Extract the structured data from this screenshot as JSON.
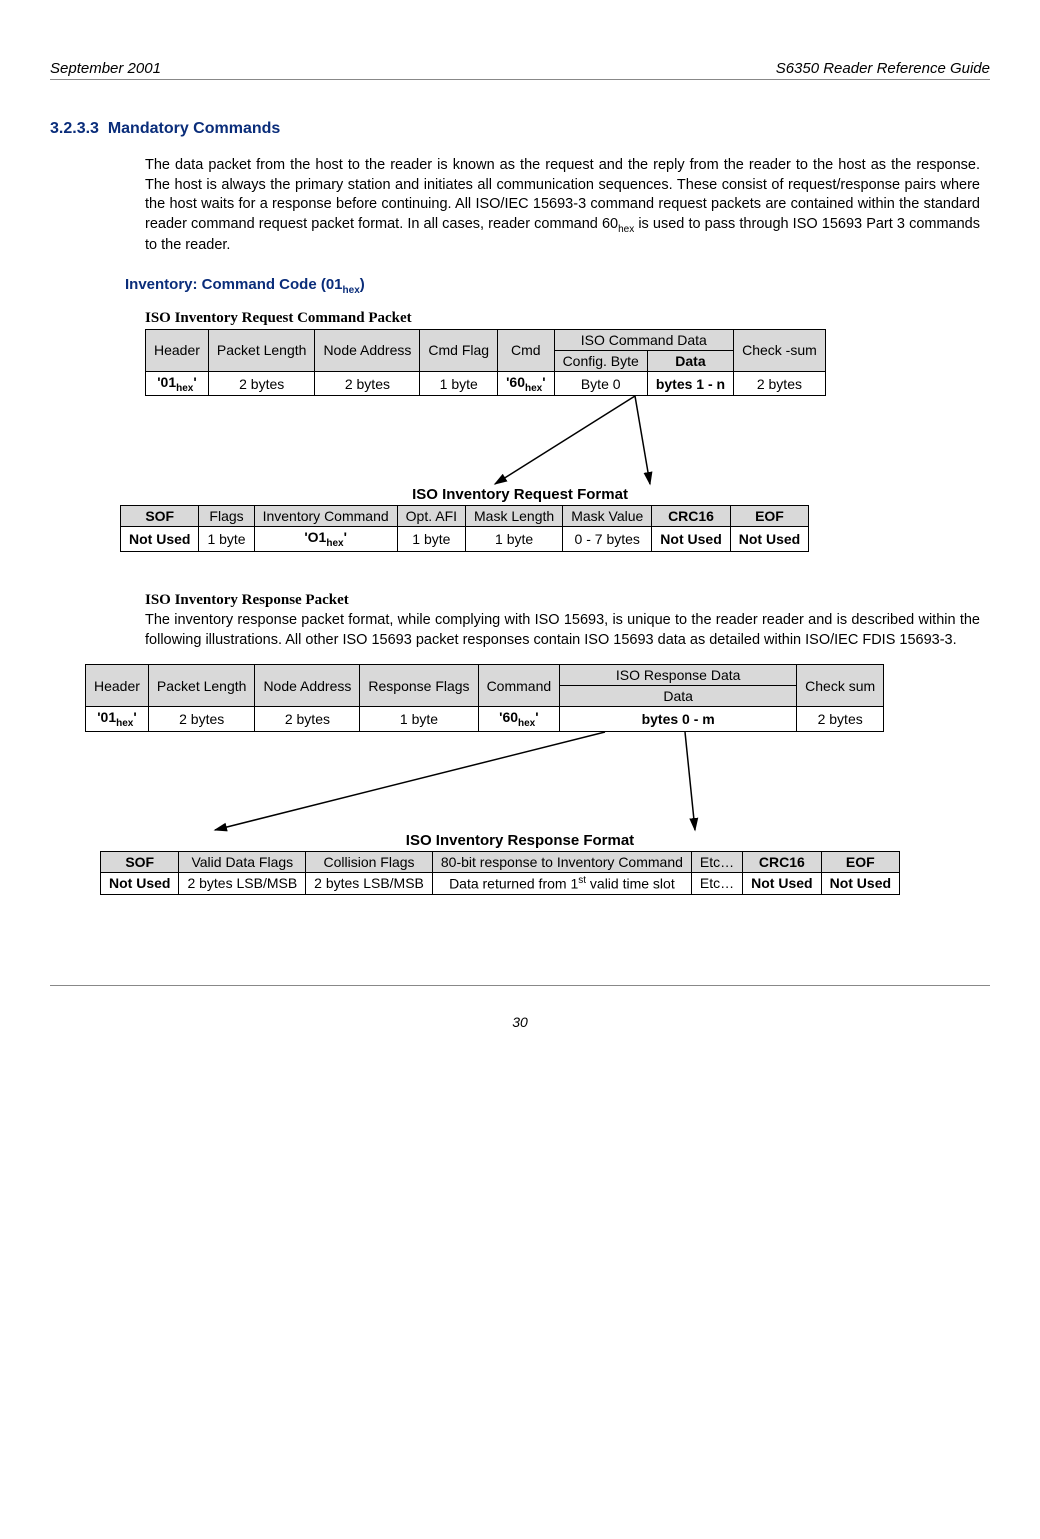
{
  "header": {
    "left": "September 2001",
    "right": "S6350 Reader Reference Guide"
  },
  "section": {
    "number": "3.2.3.3",
    "title": "Mandatory Commands"
  },
  "intro_text": "The data packet from the host to the reader is known as the request and the reply from the reader to the host as the response. The host is always the primary station and initiates all communication sequences.  These consist of request/response pairs where the host waits for a response before continuing.  All ISO/IEC 15693-3 command request packets are contained within the standard reader command request packet format.  In all cases, reader command 60",
  "intro_text_tail": " is used to pass through ISO 15693 Part 3 commands to the reader.",
  "intro_sub": "hex",
  "inventory_heading_pre": "Inventory: Command Code (01",
  "inventory_heading_sub": "hex",
  "inventory_heading_post": ")",
  "req_packet": {
    "caption": "ISO Inventory Request Command Packet",
    "headers": {
      "h1": "Header",
      "h2": "Packet Length",
      "h3": "Node Address",
      "h4": "Cmd Flag",
      "h5": "Cmd",
      "h6": "ISO Command Data",
      "h7": "Check -sum",
      "h6a": "Config. Byte",
      "h6b": "Data"
    },
    "row": {
      "c1a": "'01",
      "c1sub": "hex",
      "c1b": "'",
      "c2": "2 bytes",
      "c3": "2 bytes",
      "c4": "1 byte",
      "c5a": "'60",
      "c5sub": "hex",
      "c5b": "'",
      "c6": "Byte 0",
      "c7": "bytes 1 - n",
      "c8": "2 bytes"
    }
  },
  "req_format": {
    "caption": "ISO Inventory Request Format",
    "headers": {
      "h1": "SOF",
      "h2": "Flags",
      "h3": "Inventory Command",
      "h4": "Opt. AFI",
      "h5": "Mask Length",
      "h6": "Mask Value",
      "h7": "CRC16",
      "h8": "EOF"
    },
    "row": {
      "c1": "Not Used",
      "c2": "1 byte",
      "c3a": "'O1",
      "c3sub": "hex",
      "c3b": "'",
      "c4": "1 byte",
      "c5": "1 byte",
      "c6": "0 - 7 bytes",
      "c7": "Not Used",
      "c8": "Not Used"
    }
  },
  "resp_packet": {
    "caption": "ISO Inventory Response Packet",
    "text": "The inventory response packet format, while complying with ISO 15693, is unique to the reader reader and is described within the following illustrations.  All other ISO 15693 packet responses contain ISO 15693 data as detailed within ISO/IEC FDIS 15693-3.",
    "headers": {
      "h1": "Header",
      "h2": "Packet Length",
      "h3": "Node Address",
      "h4": "Response Flags",
      "h5": "Command",
      "h6": "ISO Response Data",
      "h7": "Check sum",
      "h6a": "Data"
    },
    "row": {
      "c1a": "'01",
      "c1sub": "hex",
      "c1b": "'",
      "c2": "2 bytes",
      "c3": "2 bytes",
      "c4": "1 byte",
      "c5a": "'60",
      "c5sub": "hex",
      "c5b": "'",
      "c6": "bytes 0 - m",
      "c7": "2 bytes"
    }
  },
  "resp_format": {
    "caption": "ISO Inventory Response Format",
    "headers": {
      "h1": "SOF",
      "h2": "Valid Data Flags",
      "h3": "Collision Flags",
      "h4": "80-bit response to Inventory Command",
      "h5": "Etc…",
      "h6": "CRC16",
      "h7": "EOF"
    },
    "row": {
      "c1": "Not Used",
      "c2": "2 bytes LSB/MSB",
      "c3": "2 bytes LSB/MSB",
      "c4pre": "Data returned from 1",
      "c4sup": "st",
      "c4post": " valid time slot",
      "c5": "Etc…",
      "c6": "Not Used",
      "c7": "Not Used"
    }
  },
  "page_number": "30"
}
